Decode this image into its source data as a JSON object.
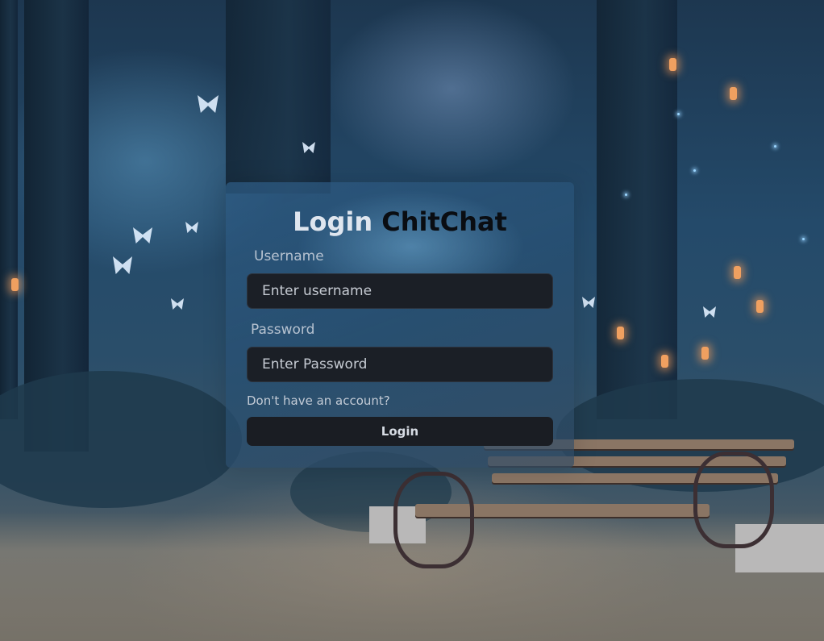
{
  "login": {
    "title_part1": "Login",
    "title_part2": "ChitChat",
    "username_label": "Username",
    "username_placeholder": "Enter username",
    "password_label": "Password",
    "password_placeholder": "Enter Password",
    "signup_link": "Don't have an account?",
    "submit_label": "Login"
  },
  "colors": {
    "card_background": "#2d5a82",
    "input_background": "#1b1f26",
    "button_background": "#1a1d23",
    "title_light": "#dfe6ef",
    "title_dark": "#0a0d12"
  }
}
